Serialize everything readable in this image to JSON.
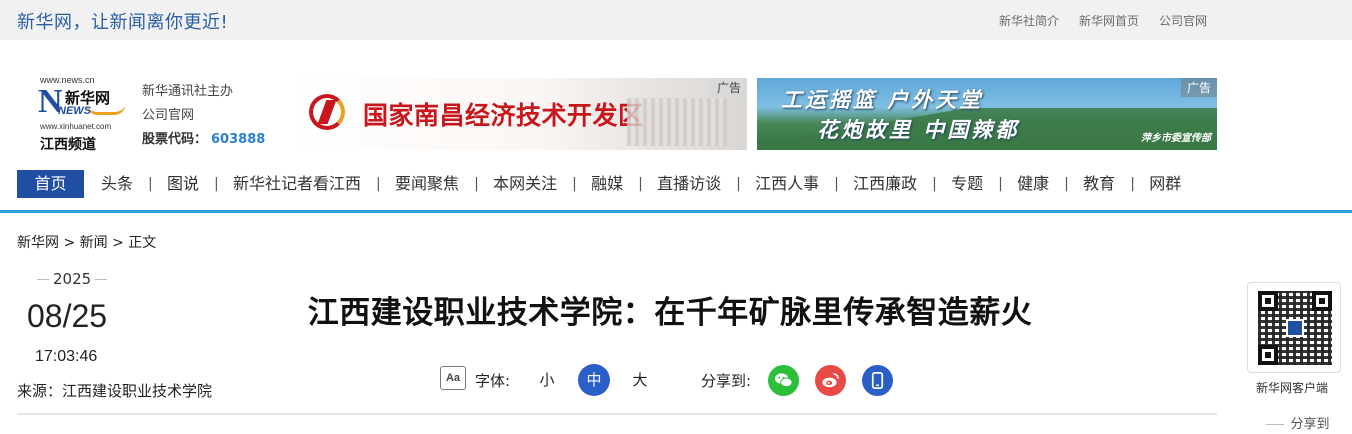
{
  "topbar": {
    "slogan": "新华网，让新闻离你更近!",
    "links": [
      "新华社简介",
      "新华网首页",
      "公司官网"
    ]
  },
  "logo": {
    "url_top": "www.news.cn",
    "brand": "新华网",
    "news": "NEWS",
    "url_bottom": "www.xinhuanet.com",
    "channel": "江西频道"
  },
  "org": {
    "line1": "新华通讯社主办",
    "line2": "公司官网",
    "stock_label": "股票代码：",
    "stock_code": "603888"
  },
  "ads": {
    "tag": "广告",
    "ad1_text": "国家南昌经济技术开发区",
    "ad2_line1": "工运摇篮  户外天堂",
    "ad2_line2": "花炮故里  中国辣都",
    "ad2_sub": "萍乡市委宣传部"
  },
  "nav": {
    "items": [
      "首页",
      "头条",
      "图说",
      "新华社记者看江西",
      "要闻聚焦",
      "本网关注",
      "融媒",
      "直播访谈",
      "江西人事",
      "江西廉政",
      "专题",
      "健康",
      "教育",
      "网群"
    ]
  },
  "breadcrumb": "新华网 > 新闻 > 正文",
  "article": {
    "year": "2025",
    "month_day": "08/25",
    "time": "17:03:46",
    "source": "来源：江西建设职业技术学院",
    "title": "江西建设职业技术学院：在千年矿脉里传承智造薪火"
  },
  "toolbar": {
    "font_icon": "Aa",
    "font_label": "字体:",
    "size_small": "小",
    "size_mid": "中",
    "size_large": "大",
    "share_label": "分享到:"
  },
  "side": {
    "qr_caption": "新华网客户端",
    "share": "分享到"
  },
  "colors": {
    "brand_blue": "#1f4ea3",
    "nav_line": "#2a9fd8",
    "wechat": "#2bbf3a",
    "weibo": "#e84a45",
    "mobile": "#2a5fc8"
  }
}
